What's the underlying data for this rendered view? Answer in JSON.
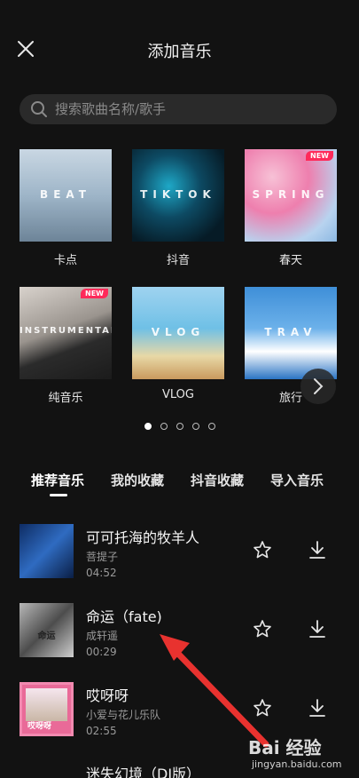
{
  "header": {
    "title": "添加音乐",
    "close_icon": "close-icon"
  },
  "search": {
    "placeholder": "搜索歌曲名称/歌手",
    "icon": "search-icon"
  },
  "categories": [
    {
      "label": "卡点",
      "cover_text": "BEAT",
      "new": false
    },
    {
      "label": "抖音",
      "cover_text": "TIKTOK",
      "new": false
    },
    {
      "label": "春天",
      "cover_text": "SPRING",
      "new": true
    },
    {
      "label": "纯音乐",
      "cover_text": "INSTRUMENTAL",
      "new": true
    },
    {
      "label": "VLOG",
      "cover_text": "VLOG",
      "new": false
    },
    {
      "label": "旅行",
      "cover_text": "TRAV",
      "new": false
    }
  ],
  "badge_text": "NEW",
  "pagination": {
    "pages": 5,
    "current": 1
  },
  "tabs": [
    {
      "label": "推荐音乐",
      "active": true
    },
    {
      "label": "我的收藏",
      "active": false
    },
    {
      "label": "抖音收藏",
      "active": false
    },
    {
      "label": "导入音乐",
      "active": false
    }
  ],
  "songs": [
    {
      "title": "可可托海的牧羊人",
      "artist": "菩提子",
      "duration": "04:52"
    },
    {
      "title": "命运（fate)",
      "artist": "成轩遥",
      "duration": "00:29"
    },
    {
      "title": "哎呀呀",
      "artist": "小爱与花儿乐队",
      "duration": "02:55"
    }
  ],
  "partial_song": {
    "title": "迷失幻境（DJ版）"
  },
  "thumb_caption": "哎呀呀",
  "thumb2_caption": "命运",
  "watermark": {
    "logo": "Bai 经验",
    "url": "jingyan.baidu.com"
  },
  "colors": {
    "background": "#121212",
    "accent_badge": "#ff2a5a",
    "annotation_arrow": "#e8322f"
  }
}
